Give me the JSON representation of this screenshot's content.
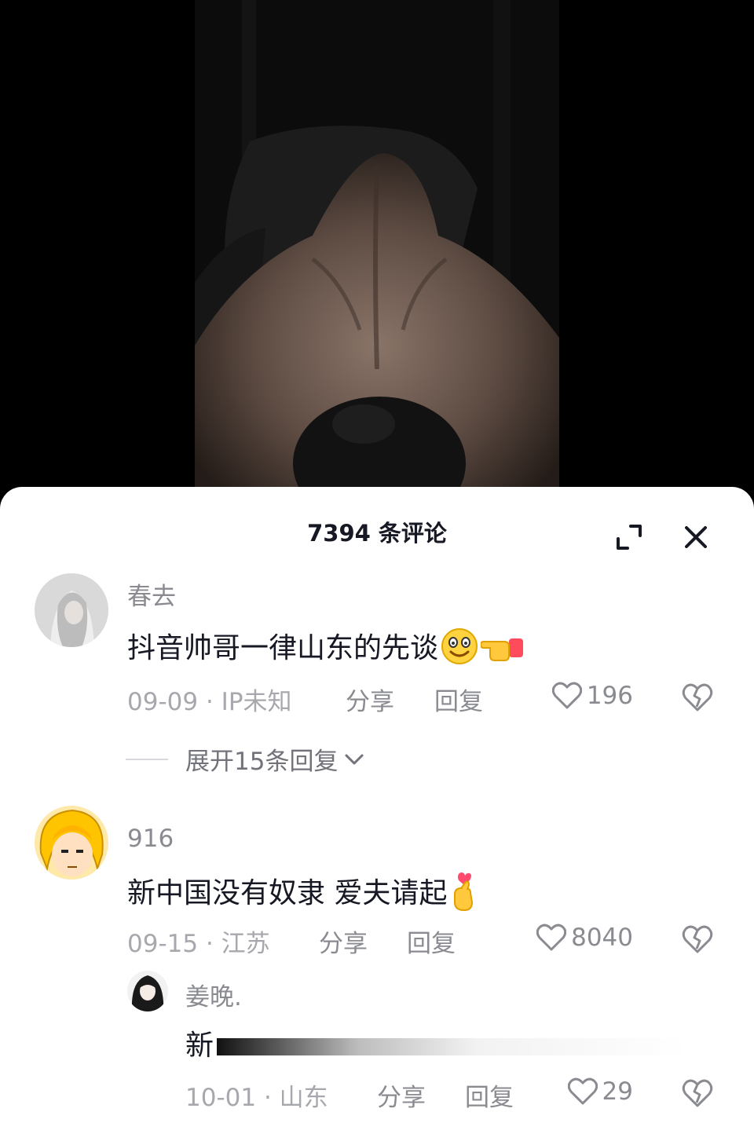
{
  "sheet": {
    "comment_count_label": "7394 条评论",
    "expand_icon": "expand-icon",
    "close_icon": "close-icon"
  },
  "comments": [
    {
      "username": "春去",
      "text": "抖音帅哥一律山东的先谈",
      "emojis": [
        "smile-emoji",
        "pointing-hand-emoji"
      ],
      "date": "09-09",
      "location": "IP未知",
      "share_label": "分享",
      "reply_label": "回复",
      "likes": "196",
      "expand_replies_label": "展开15条回复"
    },
    {
      "username": "916",
      "text": "新中国没有奴隶 爱夫请起",
      "emojis": [
        "finger-heart-emoji"
      ],
      "date": "09-15",
      "location": "江苏",
      "share_label": "分享",
      "reply_label": "回复",
      "likes": "8040"
    }
  ],
  "reply": {
    "username": "姜晚.",
    "text": "新",
    "date": "10-01",
    "location": "山东",
    "share_label": "分享",
    "reply_label": "回复",
    "likes": "29"
  },
  "colors": {
    "text_primary": "#161823",
    "text_secondary": "#8a8b91",
    "sheet_background": "#ffffff",
    "video_background": "#000000"
  }
}
